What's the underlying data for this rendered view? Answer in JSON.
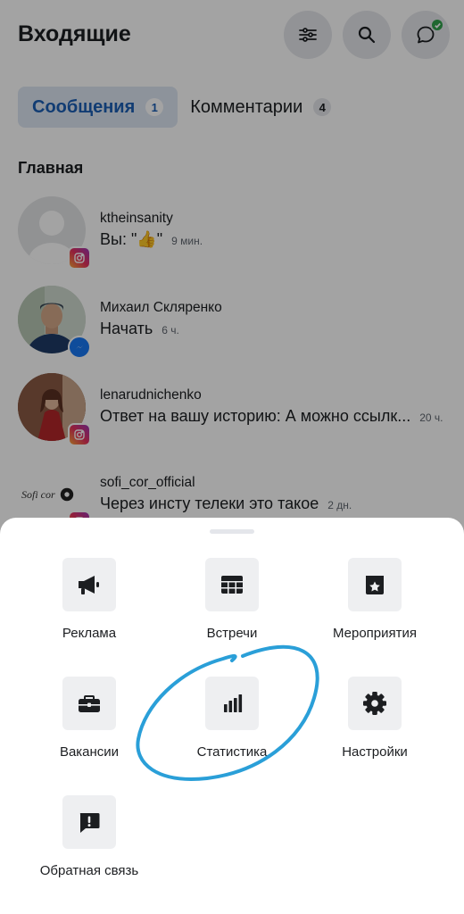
{
  "header": {
    "title": "Входящие"
  },
  "tabs": [
    {
      "label": "Сообщения",
      "count": "1"
    },
    {
      "label": "Комментарии",
      "count": "4"
    }
  ],
  "section_title": "Главная",
  "messages": [
    {
      "username": "ktheinsanity",
      "preview": "Вы: \"👍\"",
      "time": "9 мин.",
      "platform": "instagram"
    },
    {
      "username": "Михаил Скляренко",
      "preview": "Начать",
      "time": "6 ч.",
      "platform": "messenger"
    },
    {
      "username": "lenarudnichenko",
      "preview": "Ответ на вашу историю: А можно ссылк...",
      "time": "20 ч.",
      "platform": "instagram"
    },
    {
      "username": "sofi_cor_official",
      "preview": "Через инсту телеки это такое",
      "time": "2 дн.",
      "platform": "instagram",
      "avatar_text": "Sofi cor"
    }
  ],
  "sheet": {
    "options": [
      {
        "label": "Реклама",
        "icon": "megaphone-icon"
      },
      {
        "label": "Встречи",
        "icon": "calendar-icon"
      },
      {
        "label": "Мероприятия",
        "icon": "event-star-icon"
      },
      {
        "label": "Вакансии",
        "icon": "briefcase-icon"
      },
      {
        "label": "Статистика",
        "icon": "bar-chart-icon"
      },
      {
        "label": "Настройки",
        "icon": "gear-icon"
      },
      {
        "label": "Обратная связь",
        "icon": "feedback-icon"
      }
    ]
  },
  "colors": {
    "accent": "#1b5fb4",
    "annotation": "#2a9fd8",
    "online": "#31a24c"
  }
}
